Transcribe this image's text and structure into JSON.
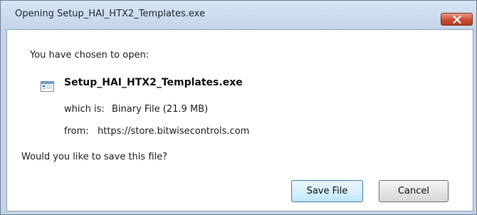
{
  "window": {
    "title": "Opening Setup_HAI_HTX2_Templates.exe"
  },
  "dialog": {
    "prompt": "You have chosen to open:",
    "file_name": "Setup_HAI_HTX2_Templates.exe",
    "file_icon": "executable-file-icon",
    "which_is_label": "which is:",
    "which_is_value": "Binary File (21.9 MB)",
    "from_label": "from:",
    "from_value": "https://store.bitwisecontrols.com",
    "question": "Would you like to save this file?"
  },
  "buttons": {
    "save_label": "Save File",
    "cancel_label": "Cancel"
  },
  "colors": {
    "title_bar": "#c4d5e9",
    "close_button": "#c94f33",
    "default_button_border": "#3c7fb1"
  }
}
